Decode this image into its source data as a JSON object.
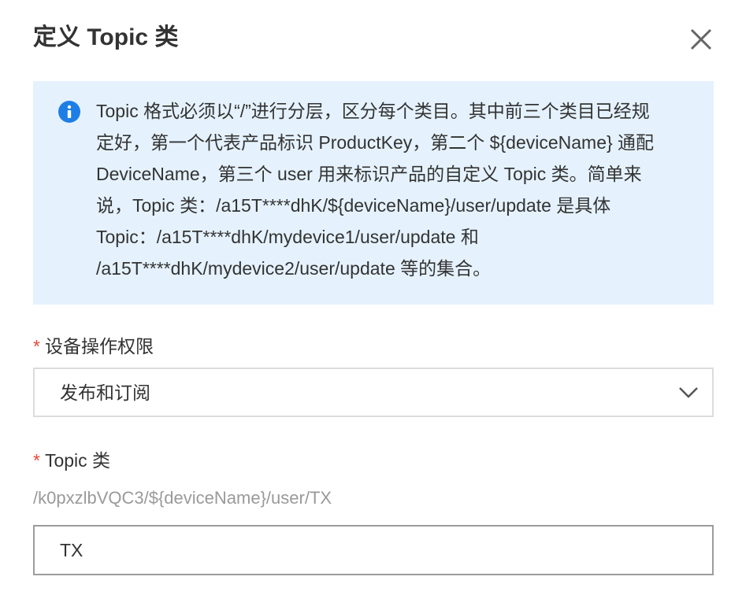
{
  "dialog": {
    "title": "定义 Topic 类",
    "close_icon": "close-icon"
  },
  "info": {
    "icon": "info-icon",
    "icon_color": "#1f7ee6",
    "background": "#e5f2fd",
    "text": "Topic 格式必须以“/”进行分层，区分每个类目。其中前三个类目已经规\n定好，第一个代表产品标识 ProductKey，第二个 ${deviceName} 通配\nDeviceName，第三个 user 用来标识产品的自定义 Topic 类。简单来\n说，Topic 类：/a15T****dhK/${deviceName}/user/update 是具体\nTopic：/a15T****dhK/mydevice1/user/update 和\n/a15T****dhK/mydevice2/user/update 等的集合。"
  },
  "permission": {
    "required_mark": "*",
    "label": "设备操作权限",
    "selected_value": "发布和订阅",
    "dropdown_icon": "chevron-down-icon"
  },
  "topic": {
    "required_mark": "*",
    "label": "Topic 类",
    "prefix": "/k0pxzlbVQC3/${deviceName}/user/TX",
    "input_value": "TX"
  },
  "colors": {
    "required": "#e84738",
    "text": "#333333",
    "muted": "#9a9a9a"
  }
}
